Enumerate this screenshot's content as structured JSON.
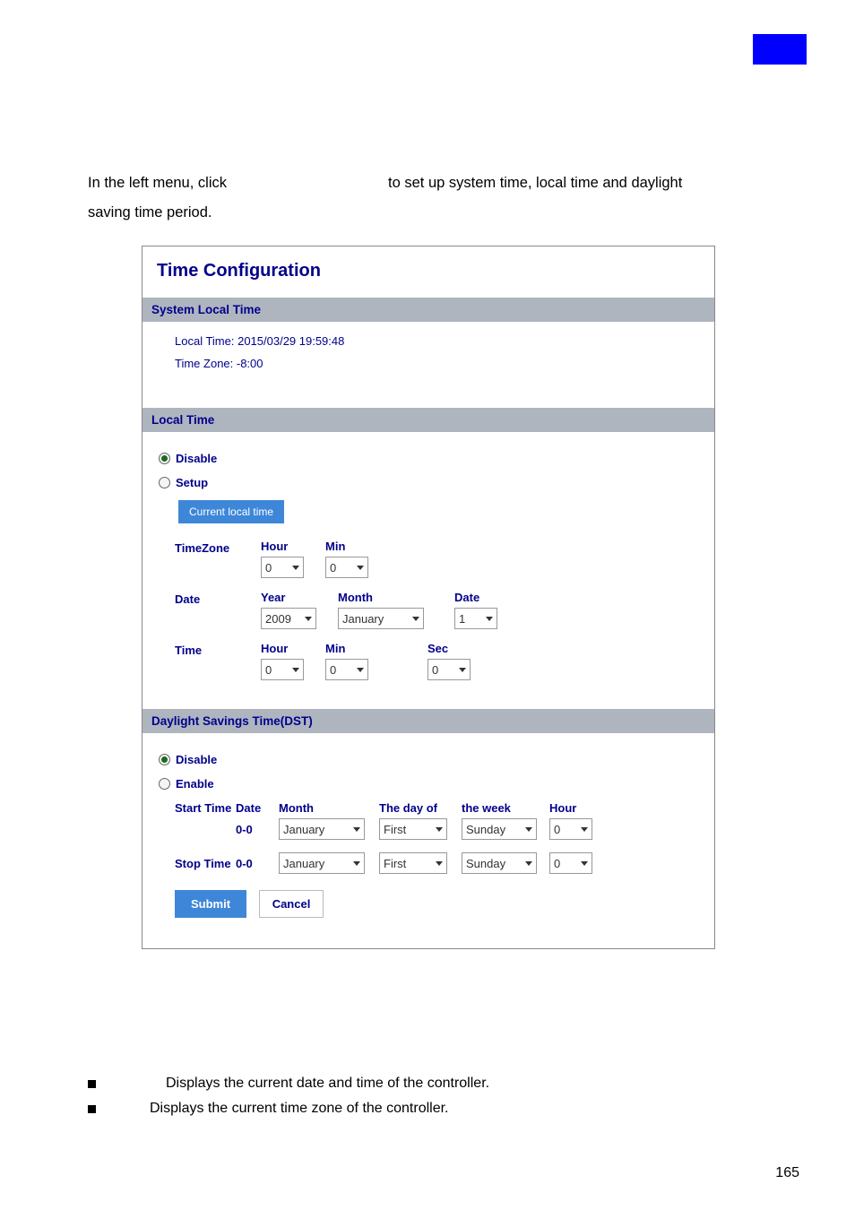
{
  "intro": {
    "line1_left": "In the left menu, click",
    "line1_right": "to set up system time, local time and daylight",
    "line2": "saving time period."
  },
  "panel": {
    "title": "Time Configuration",
    "system_local_time": {
      "header": "System Local Time",
      "local_time_label": "Local Time: 2015/03/29 19:59:48",
      "timezone_label": "Time Zone:  -8:00"
    },
    "local_time": {
      "header": "Local Time",
      "disable": "Disable",
      "setup": "Setup",
      "current_btn": "Current local time",
      "timezone_label": "TimeZone",
      "date_label": "Date",
      "time_label": "Time",
      "hour_label": "Hour",
      "min_label": "Min",
      "year_label": "Year",
      "month_label": "Month",
      "date_col_label": "Date",
      "sec_label": "Sec",
      "tz_hour": "0",
      "tz_min": "0",
      "year": "2009",
      "month": "January",
      "day": "1",
      "time_hour": "0",
      "time_min": "0",
      "time_sec": "0"
    },
    "dst": {
      "header": "Daylight Savings Time(DST)",
      "disable": "Disable",
      "enable": "Enable",
      "start_label": "Start Time",
      "stop_label": "Stop Time",
      "date_header": "Date",
      "month_header": "Month",
      "dayof_header": "The day of",
      "week_header": "the week",
      "hour_header": "Hour",
      "start_date": "0-0",
      "stop_date": "0-0",
      "start_month": "January",
      "start_dayof": "First",
      "start_week": "Sunday",
      "start_hour": "0",
      "stop_month": "January",
      "stop_dayof": "First",
      "stop_week": "Sunday",
      "stop_hour": "0"
    },
    "submit": "Submit",
    "cancel": "Cancel"
  },
  "bullets": {
    "b1": "Displays the current date and time of the controller.",
    "b2": "Displays the current time zone of the controller."
  },
  "page": "165"
}
